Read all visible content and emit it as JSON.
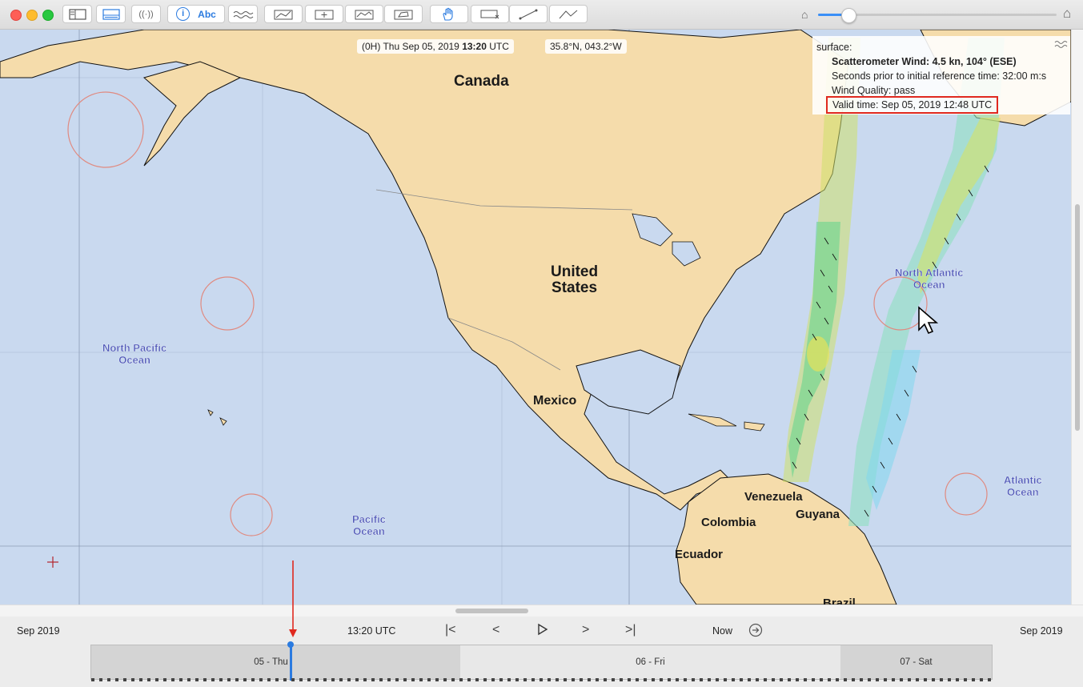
{
  "toolbar": {
    "abc_label": "Abc",
    "info_icon_char": "i"
  },
  "map": {
    "time_readout_prefix": "(0H) Thu Sep 05, 2019 ",
    "time_readout_bold": "13:20",
    "time_readout_suffix": " UTC",
    "coord_readout": "35.8°N, 043.2°W",
    "labels": {
      "canada": "Canada",
      "united_states_1": "United",
      "united_states_2": "States",
      "mexico": "Mexico",
      "venezuela": "Venezuela",
      "colombia": "Colombia",
      "guyana": "Guyana",
      "ecuador": "Ecuador",
      "brazil": "Brazil",
      "north_pacific_1": "North Pacific",
      "north_pacific_2": "Ocean",
      "pacific_1": "Pacific",
      "pacific_2": "Ocean",
      "north_atlantic_1": "North Atlantic",
      "north_atlantic_2": "Ocean",
      "atlantic_1": "Atlantic",
      "atlantic_2": "Ocean"
    }
  },
  "info_panel": {
    "heading": "surface:",
    "wind": "Scatterometer Wind: 4.5 kn, 104° (ESE)",
    "seconds": "Seconds prior to initial reference time: 32:00 m:s",
    "quality": "Wind Quality: pass",
    "valid": "Valid time: Sep 05, 2019 12:48 UTC"
  },
  "timebar": {
    "left_month": "Sep 2019",
    "right_month": "Sep 2019",
    "current_time": "13:20 UTC",
    "now_label": "Now",
    "days": [
      "05 - Thu",
      "06 - Fri",
      "07 - Sat"
    ]
  },
  "colors": {
    "land": "#f5dcab",
    "ocean": "#c9d9ef",
    "accent": "#3a8ff7",
    "highlight_red": "#e0291f",
    "circle": "#e08a80"
  }
}
